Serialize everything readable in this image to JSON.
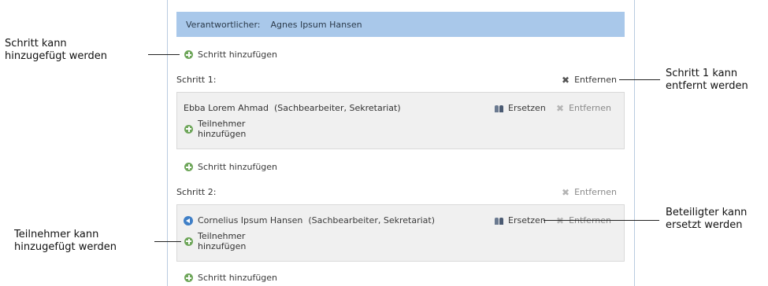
{
  "responsible": {
    "label": "Verantwortlicher:",
    "value": "Agnes Ipsum Hansen"
  },
  "add_step_label": "Schritt hinzufügen",
  "remove_label": "Entfernen",
  "replace_label": "Ersetzen",
  "add_participant": {
    "line1": "Teilnehmer",
    "line2": "hinzufügen"
  },
  "steps": [
    {
      "title": "Schritt 1:",
      "participant": {
        "name": "Ebba Lorem Ahmad",
        "role": "(Sachbearbeiter, Sekretariat)"
      }
    },
    {
      "title": "Schritt 2:",
      "participant": {
        "name": "Cornelius Ipsum Hansen",
        "role": "(Sachbearbeiter, Sekretariat)"
      }
    }
  ],
  "annotations": {
    "step_add": {
      "line1": "Schritt kann",
      "line2": "hinzugefügt werden"
    },
    "step_remove": {
      "line1": "Schritt 1 kann",
      "line2": "entfernt werden"
    },
    "participant_add": {
      "line1": "Teilnehmer kann",
      "line2": "hinzugefügt werden"
    },
    "replace": {
      "line1": "Beteiligter kann",
      "line2": "ersetzt werden"
    }
  },
  "icons": {
    "add": "plus-circle-icon",
    "remove": "x-icon",
    "replace": "people-icon",
    "back": "arrow-left-circle-icon"
  },
  "colors": {
    "header_bar": "#a9c8ea",
    "add_icon": "#6ea65a",
    "back_icon": "#3f7fc7",
    "box_bg": "#f0f0f0"
  }
}
